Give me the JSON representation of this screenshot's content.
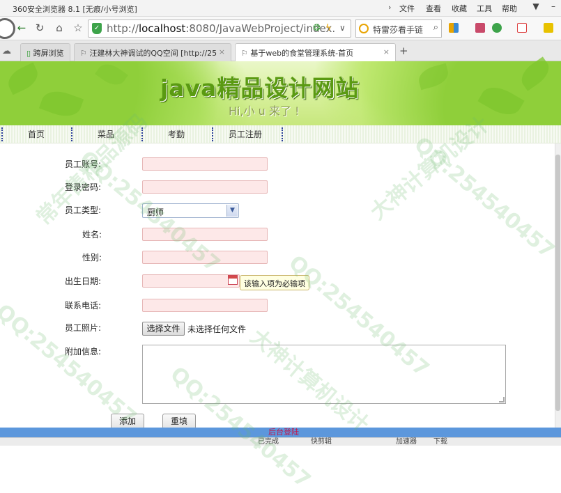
{
  "window": {
    "title": "360安全浏览器 8.1 [无痕/小号浏览]",
    "menu": [
      "文件",
      "查看",
      "收藏",
      "工具",
      "帮助"
    ]
  },
  "toolbar": {
    "url_prefix": "http://",
    "url_host": "localhost",
    "url_rest": ":8080/JavaWebProject/index.",
    "search_text": "特雷莎看手链"
  },
  "tabs": [
    {
      "label": "跨屏浏览"
    },
    {
      "label": "汪建林大神调试的QQ空间 [http://25"
    },
    {
      "label": "基于web的食堂管理系统-首页"
    }
  ],
  "banner": {
    "title": "java精品设计网站",
    "subtitle": "Hi,小 u 来了 !"
  },
  "nav": [
    "首页",
    "菜品",
    "考勤",
    "员工注册"
  ],
  "form": {
    "account_label": "员工账号:",
    "password_label": "登录密码:",
    "type_label": "员工类型:",
    "type_value": "厨师",
    "name_label": "姓名:",
    "gender_label": "性别:",
    "birth_label": "出生日期:",
    "birth_tooltip": "该输入项为必输项",
    "phone_label": "联系电话:",
    "photo_label": "员工照片:",
    "file_button": "选择文件",
    "file_status": "未选择任何文件",
    "extra_label": "附加信息:",
    "add_button": "添加",
    "reset_button": "重填"
  },
  "footer": {
    "link": "后台登陆"
  },
  "status": {
    "items": [
      "已完成",
      "快剪辑",
      "加速器",
      "下载"
    ]
  },
  "watermarks": [
    "常年售精品源码",
    "QQ:254540457",
    "大神计算机设计"
  ],
  "colors": {
    "banner_green": "#7dc52d",
    "nav_separator": "#2b3f9c",
    "footer_blue": "#5c97dc",
    "footer_link": "#c0184c",
    "field_pink": "#fde8e8"
  }
}
